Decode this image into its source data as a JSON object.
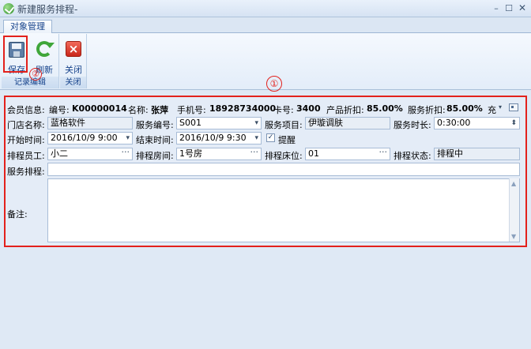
{
  "window": {
    "title": "新建服务排程-",
    "minimize": "–",
    "maximize": "☐",
    "close": "✕"
  },
  "ribbon": {
    "tab": "对象管理",
    "groups": [
      {
        "label": "记录编辑",
        "buttons": [
          {
            "label": "保存",
            "icon": "save-icon"
          },
          {
            "label": "刷新",
            "icon": "refresh-icon"
          }
        ]
      },
      {
        "label": "关闭",
        "buttons": [
          {
            "label": "关闭",
            "icon": "close-icon"
          }
        ]
      }
    ]
  },
  "annotations": {
    "one": "①",
    "two": "②"
  },
  "member": {
    "label": "会员信息:",
    "no_label": "编号:",
    "no_value": "K00000014",
    "name_label": "名称:",
    "name_value": "张萍",
    "phone_label": "手机号:",
    "phone_value": "18928734000",
    "card_label": "卡号:",
    "card_value": "3400",
    "product_discount_label": "产品折扣:",
    "product_discount_value": "85.00%",
    "service_discount_label": "服务折扣:",
    "service_discount_value": "85.00%",
    "recharge_label": "充"
  },
  "form": {
    "store_label": "门店名称:",
    "store_value": "蓝格软件",
    "service_no_label": "服务编号:",
    "service_no_value": "S001",
    "service_item_label": "服务项目:",
    "service_item_value": "伊璇调肤",
    "duration_label": "服务时长:",
    "duration_value": "0:30:00",
    "start_label": "开始时间:",
    "start_value": "2016/10/9 9:00",
    "end_label": "结束时间:",
    "end_value": "2016/10/9 9:30",
    "remind_label": "提醒",
    "remind_checked": "✓",
    "staff_label": "排程员工:",
    "staff_value": "小二",
    "room_label": "排程房间:",
    "room_value": "1号房",
    "bed_label": "排程床位:",
    "bed_value": "01",
    "status_label": "排程状态:",
    "status_value": "排程中",
    "schedule_label": "服务排程:",
    "schedule_value": "",
    "remark_label": "备注:",
    "remark_value": ""
  }
}
